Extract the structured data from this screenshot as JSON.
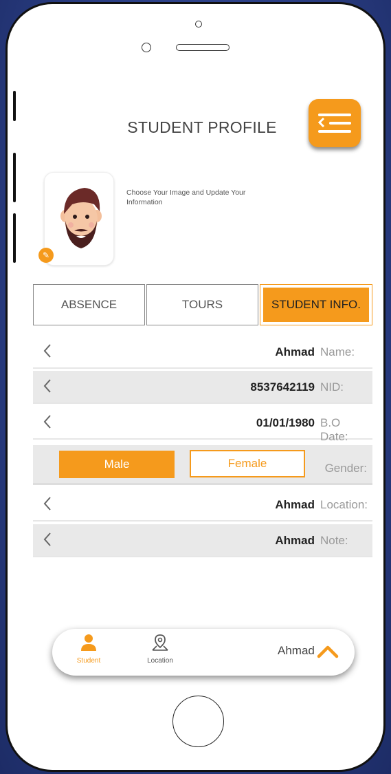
{
  "header": {
    "title": "STUDENT PROFILE"
  },
  "profile": {
    "hint": "Choose Your Image and Update Your Information"
  },
  "tabs": [
    {
      "label": "ABSENCE"
    },
    {
      "label": "TOURS"
    },
    {
      "label": "STUDENT INFO."
    }
  ],
  "fields": [
    {
      "label": "Name:",
      "value": "Ahmad"
    },
    {
      "label": "NID:",
      "value": "8537642119"
    },
    {
      "label": "B.O Date:",
      "value": "01/01/1980"
    },
    {
      "label": "Location:",
      "value": "Ahmad"
    },
    {
      "label": "Note:",
      "value": "Ahmad"
    }
  ],
  "gender": {
    "label": "Gender:",
    "male": "Male",
    "female": "Female"
  },
  "bottom_nav": {
    "student": "Student",
    "location": "Location",
    "user": "Ahmad"
  },
  "colors": {
    "accent": "#f59a1c",
    "row_gray": "#e9e9e9"
  }
}
